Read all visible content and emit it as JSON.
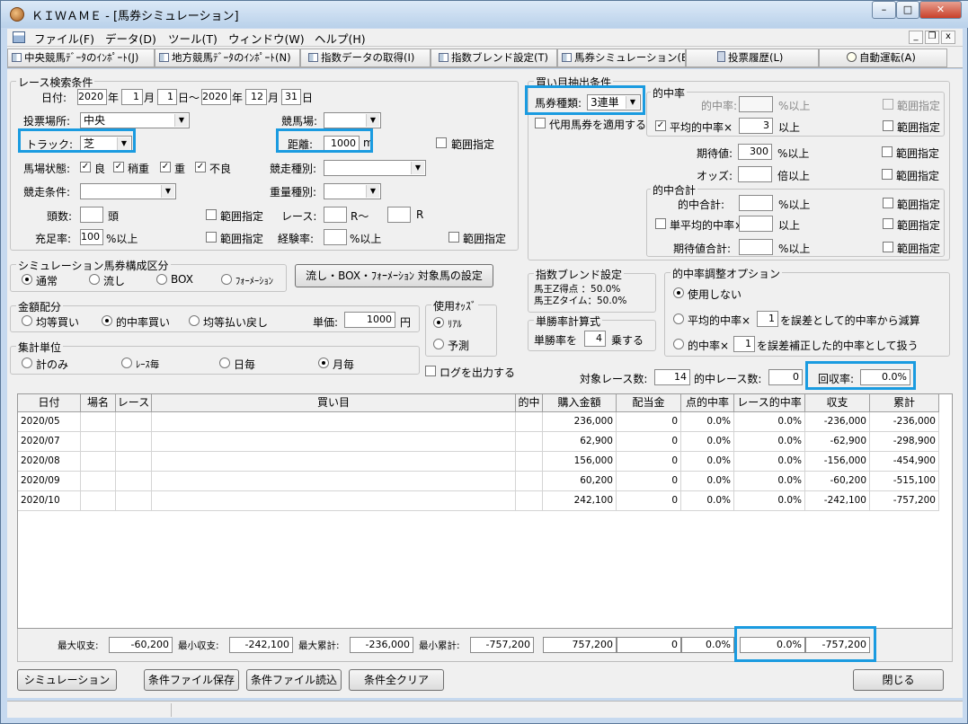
{
  "window": {
    "title": "ＫＩＷＡＭＥ - [馬券シミュレーション]",
    "minimize": "–",
    "maximize": "□",
    "close": "✕",
    "mdi_min": "_",
    "mdi_restore": "❐",
    "mdi_close": "x"
  },
  "menu": [
    "ファイル(F)",
    "データ(D)",
    "ツール(T)",
    "ウィンドウ(W)",
    "ヘルプ(H)"
  ],
  "toolbar": [
    "中央競馬ﾃﾞｰﾀのｲﾝﾎﾟｰﾄ(J)",
    "地方競馬ﾃﾞｰﾀのｲﾝﾎﾟｰﾄ(N)",
    "指数データの取得(I)",
    "指数ブレンド設定(T)",
    "馬券シミュレーション(B)",
    "投票履歴(L)",
    "自動運転(A)"
  ],
  "race_search": {
    "legend": "レース検索条件",
    "date_label": "日付:",
    "from_year": "2020",
    "year_unit": "年",
    "from_month": "1",
    "month_unit": "月",
    "from_day": "1",
    "day_unit_range": "日～",
    "to_year": "2020",
    "to_month": "12",
    "to_day": "31",
    "day_unit": "日",
    "venue_label": "投票場所:",
    "venue": "中央",
    "course_label": "競馬場:",
    "course": "",
    "track_label": "トラック:",
    "track": "芝",
    "distance_label": "距離:",
    "distance": "1000",
    "distance_unit": "m",
    "range_label": "範囲指定",
    "condition_label": "馬場状態:",
    "conditions": [
      "良",
      "稍重",
      "重",
      "不良"
    ],
    "race_type_label": "競走種別:",
    "race_cond_label": "競走条件:",
    "weight_label": "重量種別:",
    "heads_label": "頭数:",
    "heads_unit": "頭",
    "race_label": "レース:",
    "race_from_unit": "R～",
    "race_to_unit": "R",
    "fill_label": "充足率:",
    "fill_value": "100",
    "fill_unit": "%以上",
    "exp_label": "経験率:",
    "exp_unit": "%以上"
  },
  "sim_type": {
    "legend": "シミュレーション馬券構成区分",
    "options": [
      "通常",
      "流し",
      "BOX",
      "ﾌｫｰﾒｰｼｮﾝ"
    ],
    "settings_button": "流し・BOX・ﾌｫｰﾒｰｼｮﾝ 対象馬の設定"
  },
  "allocation": {
    "legend": "金額配分",
    "options": [
      "均等買い",
      "的中率買い",
      "均等払い戻し"
    ],
    "unit_price_label": "単価:",
    "unit_price": "1000",
    "unit": "円"
  },
  "odds": {
    "legend": "使用ｵｯｽﾞ",
    "options": [
      "ﾘｱﾙ",
      "予測"
    ]
  },
  "log_output": "ログを出力する",
  "aggregate": {
    "legend": "集計単位",
    "options": [
      "計のみ",
      "ﾚｰｽ毎",
      "日毎",
      "月毎"
    ]
  },
  "extract": {
    "legend": "買い目抽出条件",
    "ticket_label": "馬券種類:",
    "ticket": "3連単",
    "substitute": "代用馬券を適用する",
    "hit_legend": "的中率",
    "hit_rate_label": "的中率:",
    "hit_rate_unit": "%以上",
    "avg_hit_label": "平均的中率×",
    "avg_hit_value": "3",
    "avg_hit_unit": "以上",
    "expect_label": "期待値:",
    "expect_value": "300",
    "expect_unit": "%以上",
    "odds_label": "オッズ:",
    "odds_unit": "倍以上",
    "sum_legend": "的中合計",
    "sum_hit_label": "的中合計:",
    "sum_hit_unit": "%以上",
    "single_avg_label": "単平均的中率×",
    "single_avg_unit": "以上",
    "expect_sum_label": "期待値合計:",
    "expect_sum_unit": "%以上",
    "range_label": "範囲指定"
  },
  "blend": {
    "legend": "指数ブレンド設定",
    "line1": "馬王Z得点 ：50.0%",
    "line2": "馬王Zタイム：50.0%"
  },
  "win_rate": {
    "legend": "単勝率計算式",
    "label": "単勝率を",
    "value": "4",
    "unit": "乗する"
  },
  "adjust": {
    "legend": "的中率調整オプション",
    "opt1": "使用しない",
    "opt2_prefix": "平均的中率×",
    "opt2_value": "1",
    "opt2_suffix": "を誤差として的中率から減算",
    "opt3_prefix": "的中率×",
    "opt3_value": "1",
    "opt3_suffix": "を誤差補正した的中率として扱う"
  },
  "summary": {
    "target_label": "対象レース数:",
    "target": "14",
    "hit_label": "的中レース数:",
    "hit": "0",
    "recovery_label": "回収率:",
    "recovery": "0.0%"
  },
  "table": {
    "columns": [
      "日付",
      "場名",
      "レース",
      "買い目",
      "的中",
      "購入金額",
      "配当金",
      "点的中率",
      "レース的中率",
      "収支",
      "累計"
    ],
    "rows": [
      [
        "2020/05",
        "",
        "",
        "",
        "",
        "236,000",
        "0",
        "0.0%",
        "0.0%",
        "-236,000",
        "-236,000"
      ],
      [
        "2020/07",
        "",
        "",
        "",
        "",
        "62,900",
        "0",
        "0.0%",
        "0.0%",
        "-62,900",
        "-298,900"
      ],
      [
        "2020/08",
        "",
        "",
        "",
        "",
        "156,000",
        "0",
        "0.0%",
        "0.0%",
        "-156,000",
        "-454,900"
      ],
      [
        "2020/09",
        "",
        "",
        "",
        "",
        "60,200",
        "0",
        "0.0%",
        "0.0%",
        "-60,200",
        "-515,100"
      ],
      [
        "2020/10",
        "",
        "",
        "",
        "",
        "242,100",
        "0",
        "0.0%",
        "0.0%",
        "-242,100",
        "-757,200"
      ]
    ]
  },
  "totals": {
    "max_income_label": "最大収支:",
    "max_income": "-60,200",
    "min_income_label": "最小収支:",
    "min_income": "-242,100",
    "max_cum_label": "最大累計:",
    "max_cum": "-236,000",
    "min_cum_label": "最小累計:",
    "min_cum": "-757,200",
    "purchase": "757,200",
    "payout": "0",
    "point_hit": "0.0%",
    "race_hit": "0.0%",
    "balance": "-757,200"
  },
  "buttons": {
    "simulate": "シミュレーション",
    "save": "条件ファイル保存",
    "load": "条件ファイル読込",
    "clear": "条件全クリア",
    "close": "閉じる"
  },
  "colors": {
    "highlight": "#1a9be0"
  }
}
